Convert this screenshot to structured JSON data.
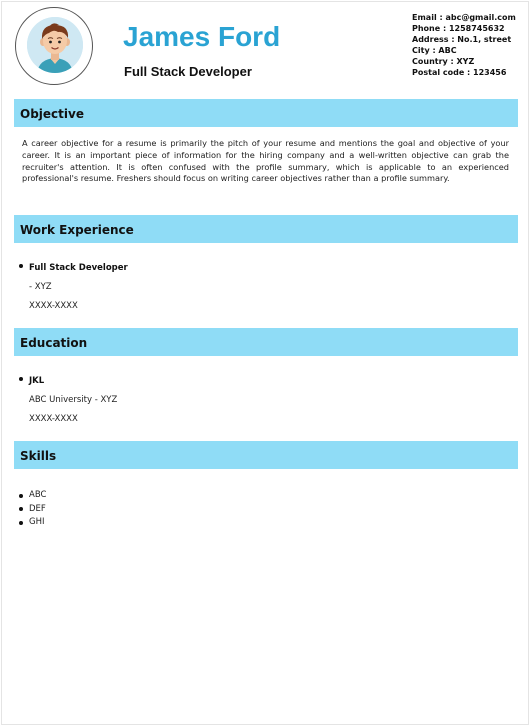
{
  "header": {
    "name": "James Ford",
    "title": "Full Stack Developer"
  },
  "contact": {
    "email": "Email : abc@gmail.com",
    "phone": "Phone : 1258745632",
    "address": "Address : No.1, street",
    "city": "City : ABC",
    "country": "Country : XYZ",
    "postal": "Postal code : 123456"
  },
  "sections": {
    "objective": {
      "heading": "Objective",
      "text": "A career objective for a resume is primarily the pitch of your resume and mentions the goal and objective of your career. It is an important piece of information for the hiring company and a well-written objective can grab the recruiter's attention. It is often confused with the profile summary, which is applicable to an experienced professional's resume. Freshers should focus on writing career objectives rather than a profile summary."
    },
    "work": {
      "heading": "Work Experience",
      "items": [
        {
          "role": "Full Stack Developer",
          "company": "- XYZ",
          "dates": "XXXX-XXXX"
        }
      ]
    },
    "education": {
      "heading": "Education",
      "items": [
        {
          "degree": "JKL",
          "school": "ABC University - XYZ",
          "dates": "XXXX-XXXX"
        }
      ]
    },
    "skills": {
      "heading": "Skills",
      "items": [
        "ABC",
        "DEF",
        "GHI"
      ]
    }
  },
  "icons": {
    "avatar": "avatar-icon"
  },
  "colors": {
    "name": "#2aa3d3",
    "section_bar": "#8fdcf6"
  }
}
